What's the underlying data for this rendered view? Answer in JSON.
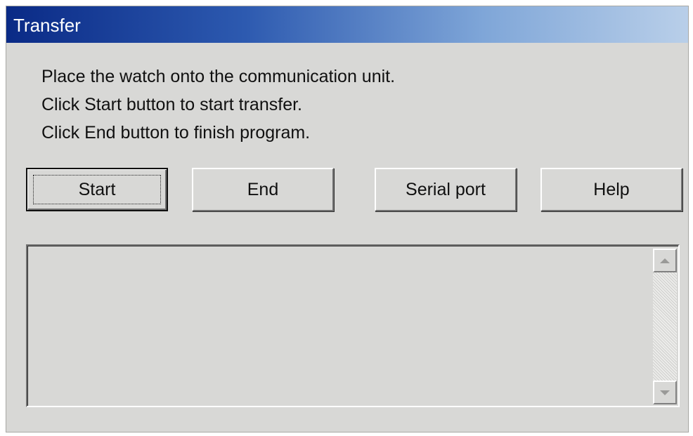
{
  "window": {
    "title": "Transfer"
  },
  "instructions": [
    "Place the watch onto the communication unit.",
    "Click Start button to start transfer.",
    "Click End button to finish program."
  ],
  "buttons": {
    "start": "Start",
    "end": "End",
    "serial_port": "Serial port",
    "help": "Help"
  },
  "log": {
    "text": ""
  },
  "icons": {
    "scroll_up": "scroll-up-arrow",
    "scroll_down": "scroll-down-arrow"
  },
  "colors": {
    "title_bar_start": "#0a2a86",
    "title_bar_end": "#b9cfe9",
    "dialog_face": "#d8d8d6"
  }
}
